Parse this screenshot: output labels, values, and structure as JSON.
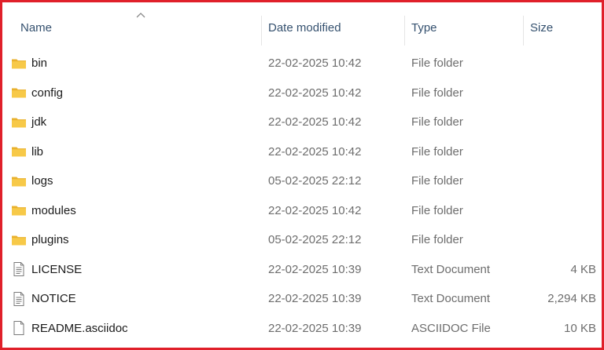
{
  "columns": {
    "name": "Name",
    "date": "Date modified",
    "type": "Type",
    "size": "Size"
  },
  "sort": {
    "column": "name",
    "icon": "sort-ascending-chevron-icon"
  },
  "colors": {
    "folder": "#f7c948",
    "header_text": "#35516f",
    "border": "#e0202a"
  },
  "files": [
    {
      "name": "bin",
      "date": "22-02-2025 10:42",
      "type": "File folder",
      "size": "",
      "icon": "folder-icon"
    },
    {
      "name": "config",
      "date": "22-02-2025 10:42",
      "type": "File folder",
      "size": "",
      "icon": "folder-icon"
    },
    {
      "name": "jdk",
      "date": "22-02-2025 10:42",
      "type": "File folder",
      "size": "",
      "icon": "folder-icon"
    },
    {
      "name": "lib",
      "date": "22-02-2025 10:42",
      "type": "File folder",
      "size": "",
      "icon": "folder-icon"
    },
    {
      "name": "logs",
      "date": "05-02-2025 22:12",
      "type": "File folder",
      "size": "",
      "icon": "folder-icon"
    },
    {
      "name": "modules",
      "date": "22-02-2025 10:42",
      "type": "File folder",
      "size": "",
      "icon": "folder-icon"
    },
    {
      "name": "plugins",
      "date": "05-02-2025 22:12",
      "type": "File folder",
      "size": "",
      "icon": "folder-icon"
    },
    {
      "name": "LICENSE",
      "date": "22-02-2025 10:39",
      "type": "Text Document",
      "size": "4 KB",
      "icon": "text-document-icon"
    },
    {
      "name": "NOTICE",
      "date": "22-02-2025 10:39",
      "type": "Text Document",
      "size": "2,294 KB",
      "icon": "text-document-icon"
    },
    {
      "name": "README.asciidoc",
      "date": "22-02-2025 10:39",
      "type": "ASCIIDOC File",
      "size": "10 KB",
      "icon": "blank-file-icon"
    }
  ]
}
